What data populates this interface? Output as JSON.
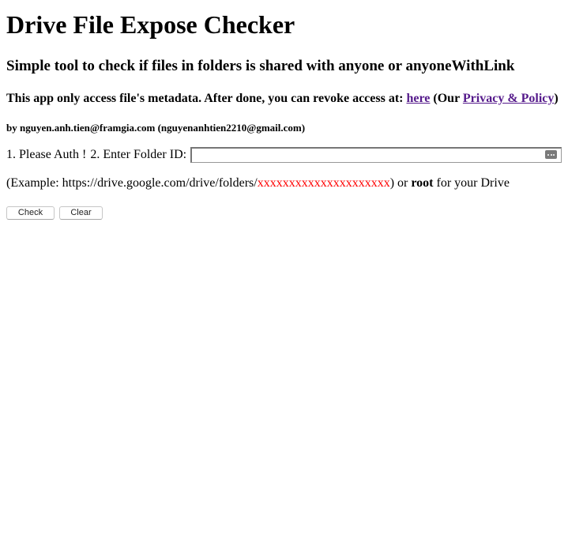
{
  "header": {
    "title": "Drive File Expose Checker",
    "subtitle": "Simple tool to check if files in folders is shared with anyone or anyoneWithLink"
  },
  "notice": {
    "text_before": "This app only access file's metadata. After done, you can revoke access at: ",
    "here_link": "here",
    "text_middle": " (Our ",
    "policy_link": "Privacy & Policy",
    "text_after": ")"
  },
  "author": {
    "text": "by nguyen.anh.tien@framgia.com (nguyenanhtien2210@gmail.com)"
  },
  "form": {
    "auth_label": "1. Please Auth !",
    "folder_label": "2. Enter Folder ID:",
    "folder_value": "",
    "folder_placeholder": ""
  },
  "example": {
    "prefix": "(Example: https://drive.google.com/drive/folders/",
    "folder_id": "xxxxxxxxxxxxxxxxxxxxx",
    "middle": ") or ",
    "root": "root",
    "suffix": " for your Drive",
    "highlight_color": "#ff0000"
  },
  "buttons": {
    "check_label": "Check",
    "clear_label": "Clear"
  },
  "icons": {
    "input_icon": "keychain-autofill-icon"
  },
  "colors": {
    "link_visited": "#551a8b"
  }
}
